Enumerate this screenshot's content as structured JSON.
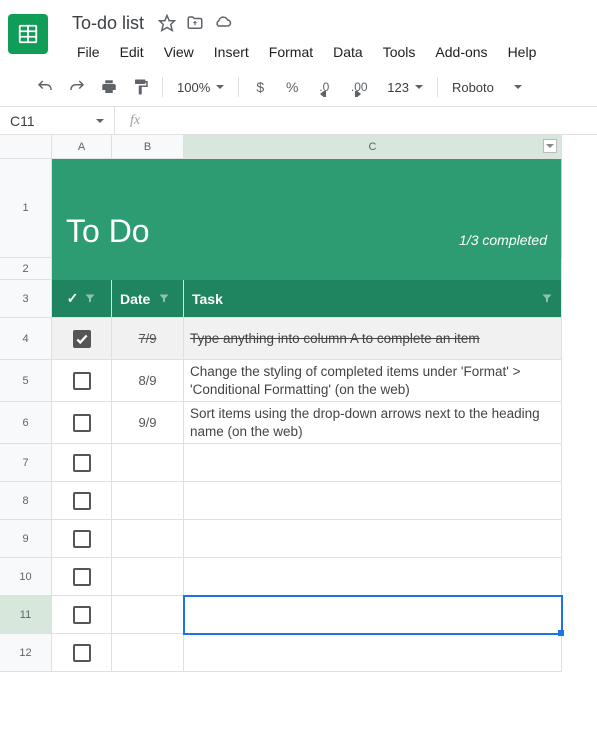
{
  "doc": {
    "title": "To-do list"
  },
  "menu": {
    "file": "File",
    "edit": "Edit",
    "view": "View",
    "insert": "Insert",
    "format": "Format",
    "data": "Data",
    "tools": "Tools",
    "addons": "Add-ons",
    "help": "Help"
  },
  "toolbar": {
    "zoom": "100%",
    "currency": "$",
    "percent": "%",
    "dec_dec": ".0",
    "dec_inc": ".00",
    "numfmt": "123",
    "font": "Roboto"
  },
  "namebox": {
    "cell": "C11",
    "fx": "fx"
  },
  "columns": {
    "a": "A",
    "b": "B",
    "c": "C"
  },
  "rows": [
    "1",
    "2",
    "3",
    "4",
    "5",
    "6",
    "7",
    "8",
    "9",
    "10",
    "11",
    "12"
  ],
  "banner": {
    "title": "To Do",
    "status": "1/3 completed"
  },
  "headers": {
    "check": "✓",
    "date": "Date",
    "task": "Task"
  },
  "items": [
    {
      "done": true,
      "date": "7/9",
      "task": "Type anything into column A to complete an item"
    },
    {
      "done": false,
      "date": "8/9",
      "task": "Change the styling of completed items under 'Format' > 'Conditional Formatting' (on the web)"
    },
    {
      "done": false,
      "date": "9/9",
      "task": "Sort items using the drop-down arrows next to the heading name (on the web)"
    },
    {
      "done": false,
      "date": "",
      "task": ""
    },
    {
      "done": false,
      "date": "",
      "task": ""
    },
    {
      "done": false,
      "date": "",
      "task": ""
    },
    {
      "done": false,
      "date": "",
      "task": ""
    },
    {
      "done": false,
      "date": "",
      "task": ""
    },
    {
      "done": false,
      "date": "",
      "task": ""
    }
  ]
}
